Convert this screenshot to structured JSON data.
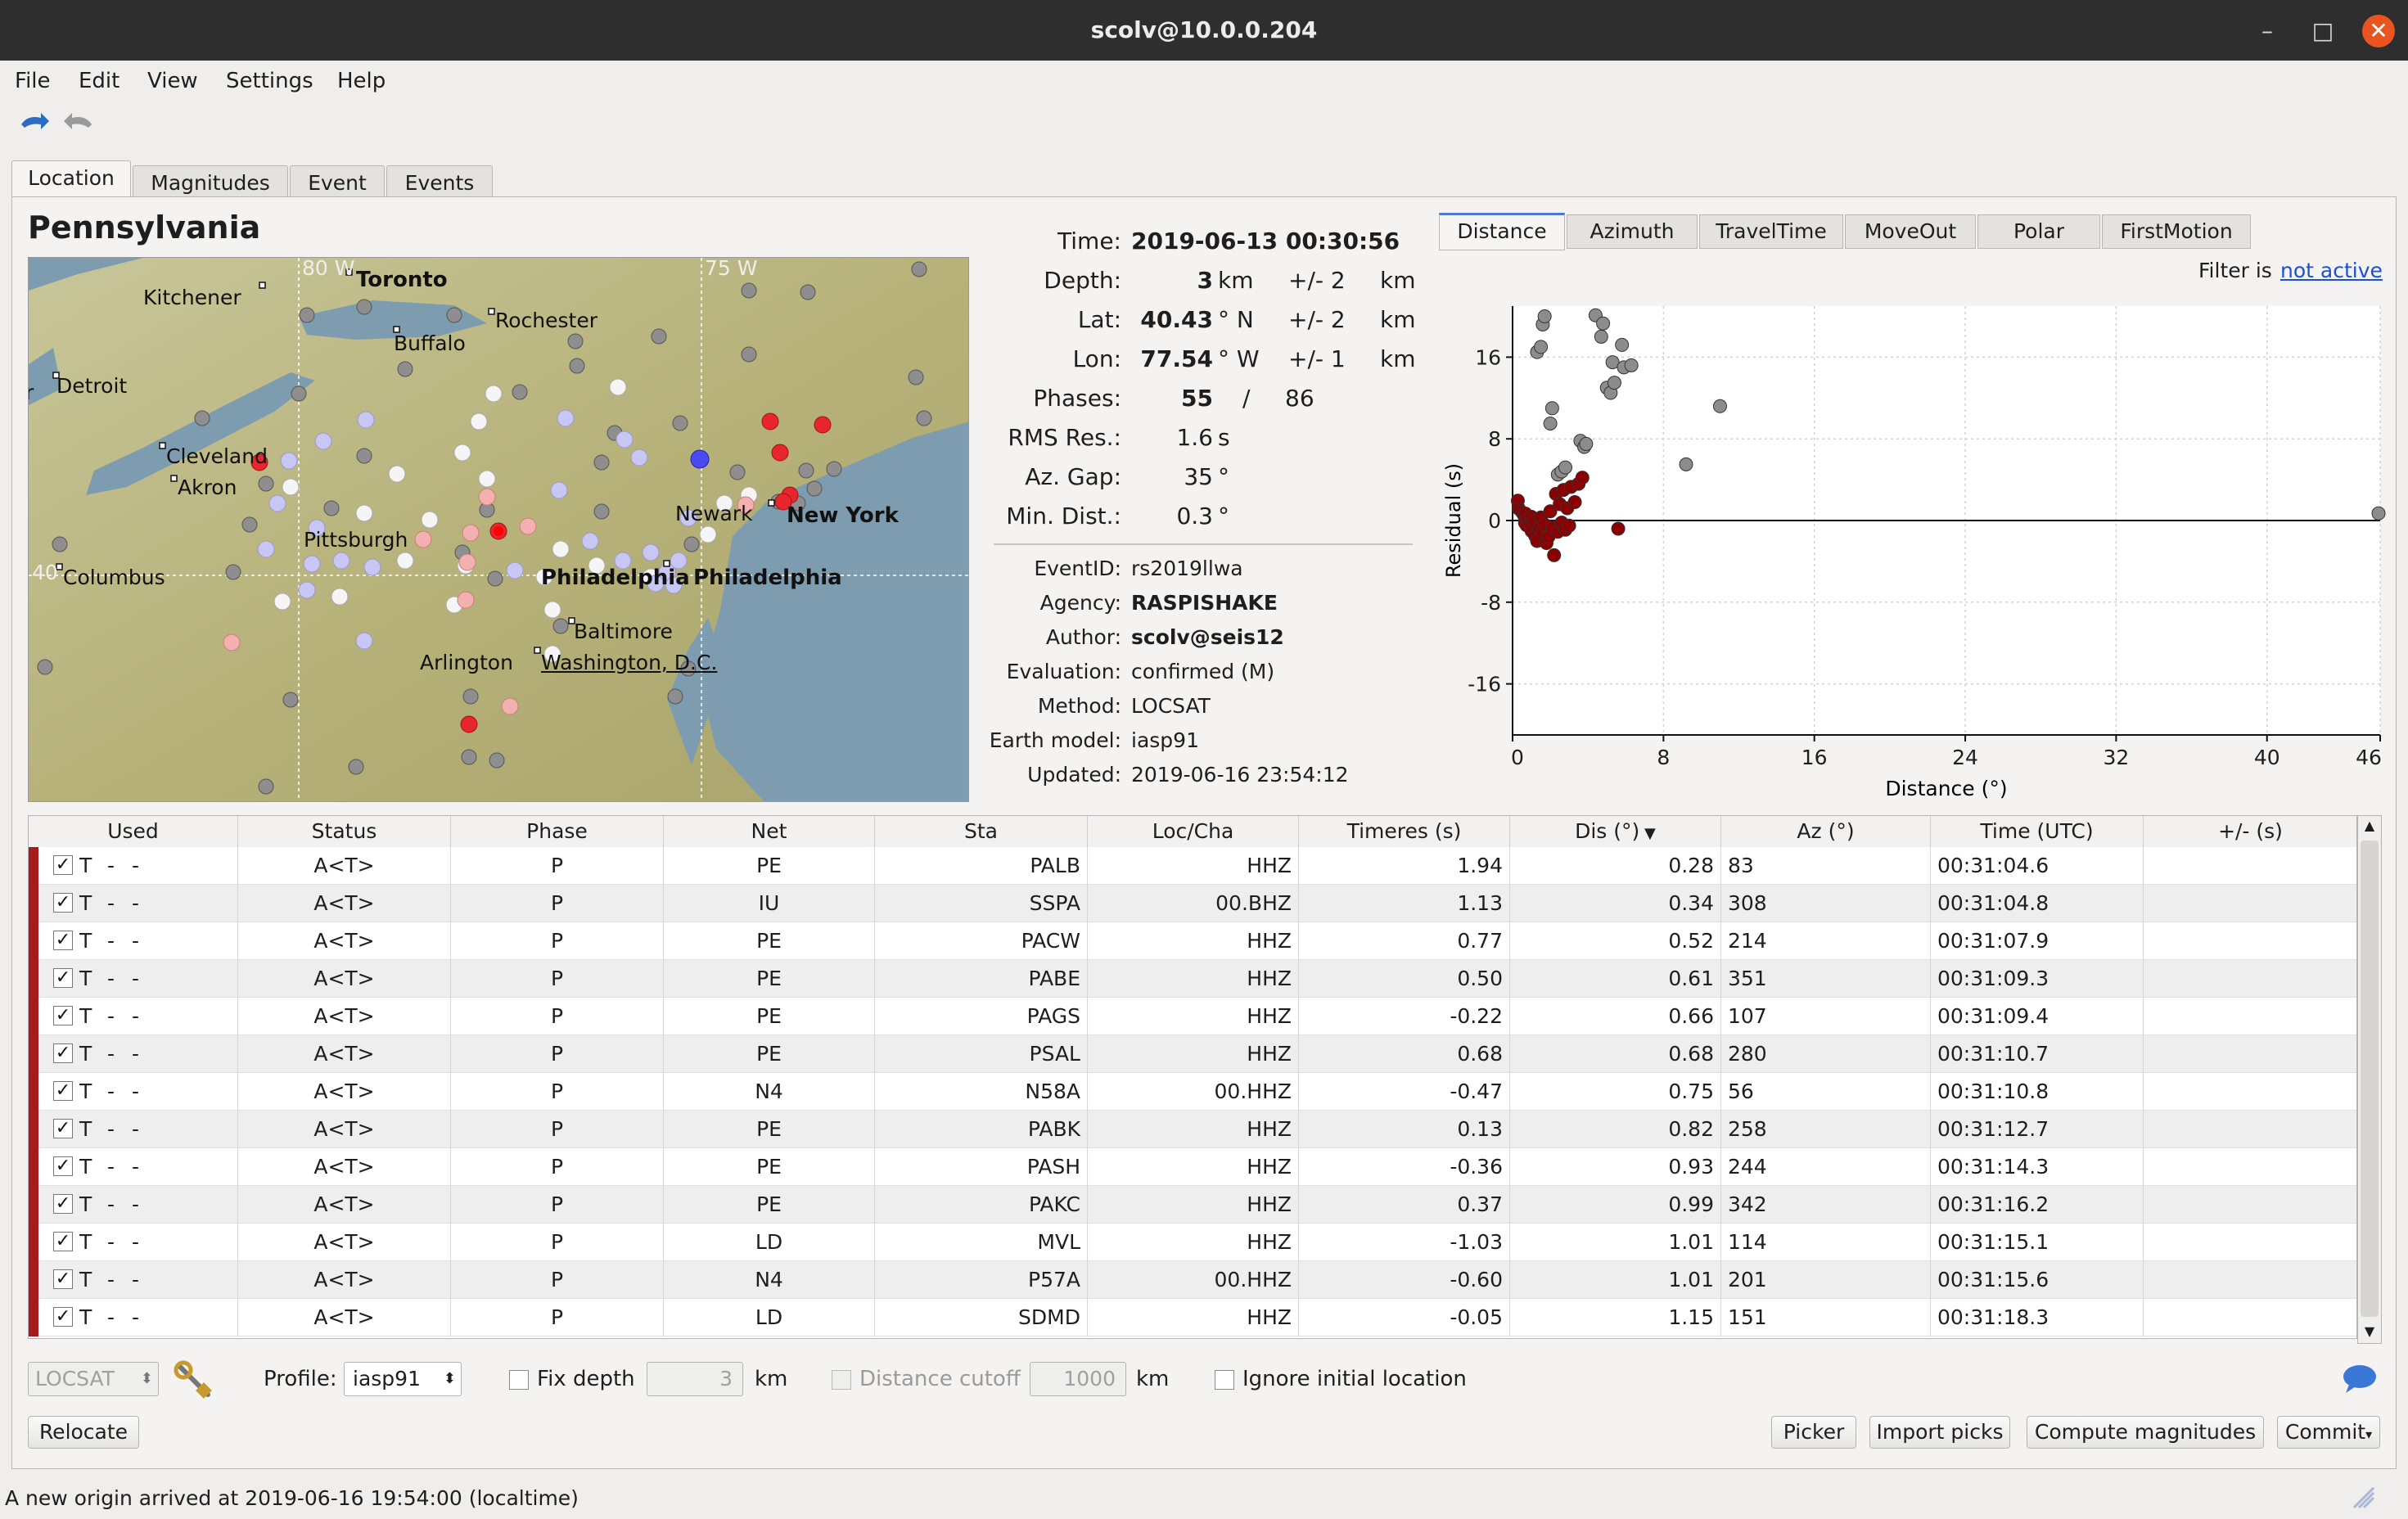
{
  "window": {
    "title": "scolv@10.0.0.204",
    "minimize": "–",
    "maximize": "□",
    "close": "✕"
  },
  "menu": [
    "File",
    "Edit",
    "View",
    "Settings",
    "Help"
  ],
  "toolbar_icons": [
    "undo-icon",
    "redo-icon"
  ],
  "main_tabs": [
    "Location",
    "Magnitudes",
    "Event",
    "Events"
  ],
  "region_title": "Pennsylvania",
  "map": {
    "grid_labels": {
      "lon80": "80 W",
      "lon75": "75 W",
      "lat40": "40"
    },
    "cities": [
      "Toronto",
      "Kitchener",
      "Rochester",
      "Buffalo",
      "Detroit",
      "Cleveland",
      "Akron",
      "Pittsburgh",
      "Columbus",
      "Philadelphia",
      "Philadelphia",
      "Newark",
      "New York",
      "Baltimore",
      "Arlington",
      "Washington, D.C."
    ],
    "edge_letter": "r"
  },
  "origin": {
    "time_label": "Time:",
    "time": "2019-06-13 00:30:56",
    "depth_label": "Depth:",
    "depth": "3",
    "depth_unit": "km",
    "depth_err": "+/- 2",
    "depth_err_unit": "km",
    "lat_label": "Lat:",
    "lat": "40.43",
    "lat_unit": "° N",
    "lat_err": "+/- 2",
    "lat_err_unit": "km",
    "lon_label": "Lon:",
    "lon": "77.54",
    "lon_unit": "° W",
    "lon_err": "+/- 1",
    "lon_err_unit": "km",
    "phases_label": "Phases:",
    "phases_used": "55",
    "phases_sep": "/",
    "phases_total": "86",
    "rms_label": "RMS Res.:",
    "rms": "1.6",
    "rms_unit": "s",
    "azgap_label": "Az. Gap:",
    "azgap": "35",
    "azgap_unit": "°",
    "mindist_label": "Min. Dist.:",
    "mindist": "0.3",
    "mindist_unit": "°"
  },
  "event_info": {
    "eventid_label": "EventID:",
    "eventid": "rs2019llwa",
    "agency_label": "Agency:",
    "agency": "RASPISHAKE",
    "author_label": "Author:",
    "author": "scolv@seis12",
    "evaluation_label": "Evaluation:",
    "evaluation": "confirmed (M)",
    "method_label": "Method:",
    "method": "LOCSAT",
    "earthmodel_label": "Earth model:",
    "earthmodel": "iasp91",
    "updated_label": "Updated:",
    "updated": "2019-06-16 23:54:12"
  },
  "plot_tabs": [
    "Distance",
    "Azimuth",
    "TravelTime",
    "MoveOut",
    "Polar",
    "FirstMotion"
  ],
  "filter": {
    "label": "Filter is",
    "link": "not active"
  },
  "chart_data": {
    "type": "scatter",
    "xlabel": "Distance (°)",
    "ylabel": "Residual (s)",
    "xlim": [
      0,
      46
    ],
    "ylim": [
      -21,
      21
    ],
    "xticks": [
      "0",
      "8",
      "16",
      "24",
      "32",
      "40",
      "46"
    ],
    "xtick_values": [
      0,
      8,
      16,
      24,
      32,
      40,
      46
    ],
    "yticks": [
      "16",
      "8",
      "0",
      "-8",
      "-16"
    ],
    "ytick_values": [
      16,
      8,
      0,
      -8,
      -16
    ],
    "grid": true,
    "series": [
      {
        "color": "#8b0000",
        "points": [
          [
            0.28,
            1.94
          ],
          [
            0.34,
            1.13
          ],
          [
            0.52,
            0.77
          ],
          [
            0.61,
            0.5
          ],
          [
            0.66,
            -0.22
          ],
          [
            0.68,
            0.68
          ],
          [
            0.75,
            -0.47
          ],
          [
            0.82,
            0.13
          ],
          [
            0.93,
            -0.36
          ],
          [
            0.99,
            0.37
          ],
          [
            1.01,
            -1.03
          ],
          [
            1.01,
            -0.6
          ],
          [
            1.15,
            -0.05
          ],
          [
            1.2,
            -1.5
          ],
          [
            1.3,
            -2.0
          ],
          [
            1.4,
            -0.8
          ],
          [
            1.5,
            0.3
          ],
          [
            1.6,
            -1.2
          ],
          [
            1.7,
            -0.4
          ],
          [
            1.8,
            -2.2
          ],
          [
            1.9,
            -1.6
          ],
          [
            2.0,
            0.9
          ],
          [
            2.1,
            -0.7
          ],
          [
            2.2,
            -3.4
          ],
          [
            2.3,
            2.6
          ],
          [
            2.4,
            -1.1
          ],
          [
            2.5,
            1.6
          ],
          [
            2.6,
            -0.2
          ],
          [
            2.7,
            3.0
          ],
          [
            2.8,
            -0.9
          ],
          [
            2.9,
            1.2
          ],
          [
            3.0,
            -0.5
          ],
          [
            3.1,
            3.3
          ],
          [
            3.3,
            1.8
          ],
          [
            3.5,
            3.6
          ],
          [
            3.7,
            4.2
          ],
          [
            5.6,
            -0.8
          ]
        ]
      },
      {
        "color": "#8c8c8c",
        "points": [
          [
            1.3,
            16.5
          ],
          [
            1.5,
            17.0
          ],
          [
            1.6,
            19.2
          ],
          [
            1.7,
            20.0
          ],
          [
            2.0,
            9.5
          ],
          [
            2.1,
            11.0
          ],
          [
            2.4,
            4.5
          ],
          [
            2.6,
            4.8
          ],
          [
            2.8,
            5.2
          ],
          [
            3.6,
            7.8
          ],
          [
            3.8,
            7.2
          ],
          [
            3.9,
            7.5
          ],
          [
            4.4,
            20.1
          ],
          [
            4.7,
            18.0
          ],
          [
            4.8,
            19.3
          ],
          [
            5.0,
            13.0
          ],
          [
            5.2,
            12.5
          ],
          [
            5.3,
            15.5
          ],
          [
            5.4,
            13.5
          ],
          [
            5.8,
            17.2
          ],
          [
            5.9,
            15.0
          ],
          [
            6.3,
            15.2
          ],
          [
            9.2,
            5.5
          ],
          [
            11.0,
            11.2
          ],
          [
            46.0,
            0.7
          ]
        ]
      }
    ]
  },
  "table": {
    "columns": [
      "Used",
      "Status",
      "Phase",
      "Net",
      "Sta",
      "Loc/Cha",
      "Timeres (s)",
      "Dis (°)",
      "Az (°)",
      "Time (UTC)",
      "+/- (s)"
    ],
    "sort_indicator": "▼",
    "rows": [
      {
        "used": "T",
        "dash1": "-",
        "dash2": "-",
        "status": "A<T>",
        "phase": "P",
        "net": "PE",
        "sta": "PALB",
        "loccha": "HHZ",
        "timeres": "1.94",
        "dis": "0.28",
        "az": "83",
        "time": "00:31:04.6",
        "err": ""
      },
      {
        "used": "T",
        "dash1": "-",
        "dash2": "-",
        "status": "A<T>",
        "phase": "P",
        "net": "IU",
        "sta": "SSPA",
        "loccha": "00.BHZ",
        "timeres": "1.13",
        "dis": "0.34",
        "az": "308",
        "time": "00:31:04.8",
        "err": ""
      },
      {
        "used": "T",
        "dash1": "-",
        "dash2": "-",
        "status": "A<T>",
        "phase": "P",
        "net": "PE",
        "sta": "PACW",
        "loccha": "HHZ",
        "timeres": "0.77",
        "dis": "0.52",
        "az": "214",
        "time": "00:31:07.9",
        "err": ""
      },
      {
        "used": "T",
        "dash1": "-",
        "dash2": "-",
        "status": "A<T>",
        "phase": "P",
        "net": "PE",
        "sta": "PABE",
        "loccha": "HHZ",
        "timeres": "0.50",
        "dis": "0.61",
        "az": "351",
        "time": "00:31:09.3",
        "err": ""
      },
      {
        "used": "T",
        "dash1": "-",
        "dash2": "-",
        "status": "A<T>",
        "phase": "P",
        "net": "PE",
        "sta": "PAGS",
        "loccha": "HHZ",
        "timeres": "-0.22",
        "dis": "0.66",
        "az": "107",
        "time": "00:31:09.4",
        "err": ""
      },
      {
        "used": "T",
        "dash1": "-",
        "dash2": "-",
        "status": "A<T>",
        "phase": "P",
        "net": "PE",
        "sta": "PSAL",
        "loccha": "HHZ",
        "timeres": "0.68",
        "dis": "0.68",
        "az": "280",
        "time": "00:31:10.7",
        "err": ""
      },
      {
        "used": "T",
        "dash1": "-",
        "dash2": "-",
        "status": "A<T>",
        "phase": "P",
        "net": "N4",
        "sta": "N58A",
        "loccha": "00.HHZ",
        "timeres": "-0.47",
        "dis": "0.75",
        "az": "56",
        "time": "00:31:10.8",
        "err": ""
      },
      {
        "used": "T",
        "dash1": "-",
        "dash2": "-",
        "status": "A<T>",
        "phase": "P",
        "net": "PE",
        "sta": "PABK",
        "loccha": "HHZ",
        "timeres": "0.13",
        "dis": "0.82",
        "az": "258",
        "time": "00:31:12.7",
        "err": ""
      },
      {
        "used": "T",
        "dash1": "-",
        "dash2": "-",
        "status": "A<T>",
        "phase": "P",
        "net": "PE",
        "sta": "PASH",
        "loccha": "HHZ",
        "timeres": "-0.36",
        "dis": "0.93",
        "az": "244",
        "time": "00:31:14.3",
        "err": ""
      },
      {
        "used": "T",
        "dash1": "-",
        "dash2": "-",
        "status": "A<T>",
        "phase": "P",
        "net": "PE",
        "sta": "PAKC",
        "loccha": "HHZ",
        "timeres": "0.37",
        "dis": "0.99",
        "az": "342",
        "time": "00:31:16.2",
        "err": ""
      },
      {
        "used": "T",
        "dash1": "-",
        "dash2": "-",
        "status": "A<T>",
        "phase": "P",
        "net": "LD",
        "sta": "MVL",
        "loccha": "HHZ",
        "timeres": "-1.03",
        "dis": "1.01",
        "az": "114",
        "time": "00:31:15.1",
        "err": ""
      },
      {
        "used": "T",
        "dash1": "-",
        "dash2": "-",
        "status": "A<T>",
        "phase": "P",
        "net": "N4",
        "sta": "P57A",
        "loccha": "00.HHZ",
        "timeres": "-0.60",
        "dis": "1.01",
        "az": "201",
        "time": "00:31:15.6",
        "err": ""
      },
      {
        "used": "T",
        "dash1": "-",
        "dash2": "-",
        "status": "A<T>",
        "phase": "P",
        "net": "LD",
        "sta": "SDMD",
        "loccha": "HHZ",
        "timeres": "-0.05",
        "dis": "1.15",
        "az": "151",
        "time": "00:31:18.3",
        "err": ""
      }
    ]
  },
  "controls": {
    "locator": "LOCSAT",
    "profile_label": "Profile:",
    "profile": "iasp91",
    "fix_depth_label": "Fix depth",
    "fix_depth_value": "3",
    "fix_depth_unit": "km",
    "distance_cutoff_label": "Distance cutoff",
    "distance_cutoff_value": "1000",
    "distance_cutoff_unit": "km",
    "ignore_initial_label": "Ignore initial location",
    "relocate": "Relocate",
    "picker": "Picker",
    "import_picks": "Import picks",
    "compute_magnitudes": "Compute magnitudes",
    "commit": "Commit"
  },
  "status_bar": "A new origin arrived at 2019-06-16 19:54:00 (localtime)"
}
